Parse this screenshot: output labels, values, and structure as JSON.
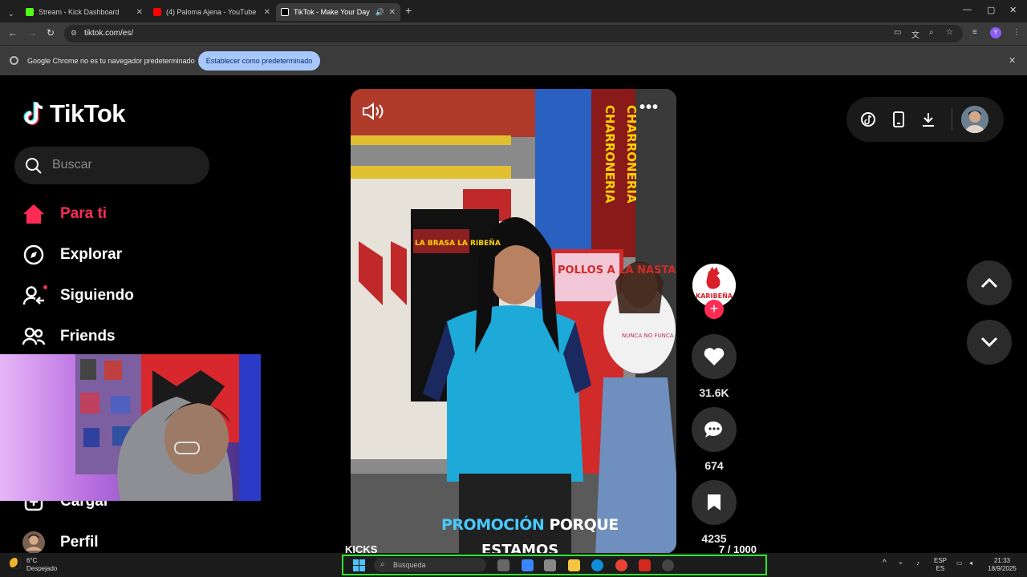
{
  "browser": {
    "tabs": [
      {
        "title": "Stream - Kick Dashboard",
        "color": "#53fc18"
      },
      {
        "title": "(4) Paloma Ajena - YouTube",
        "color": "#ff0000"
      },
      {
        "title": "TikTok - Make Your Day",
        "color": "#000000"
      }
    ],
    "url": "tiktok.com/es/",
    "profile_initial": "Y"
  },
  "infobar": {
    "message": "Google Chrome no es tu navegador predeterminado",
    "button": "Establecer como predeterminado"
  },
  "tiktok": {
    "logo": "TikTok",
    "search_placeholder": "Buscar",
    "nav": [
      {
        "label": "Para ti",
        "icon": "home-icon"
      },
      {
        "label": "Explorar",
        "icon": "compass-icon"
      },
      {
        "label": "Siguiendo",
        "icon": "following-icon"
      },
      {
        "label": "Friends",
        "icon": "friends-icon"
      },
      {
        "label": "Cargar",
        "icon": "upload-icon"
      },
      {
        "label": "Perfil",
        "icon": "profile-icon"
      }
    ],
    "video": {
      "caption_highlight": "PROMOCIÓN",
      "caption_rest": "PORQUE",
      "caption_line2": "ESTAMOS",
      "channel": "KICKS",
      "signs": [
        "CHARRONERIA",
        "POLLOS A LA NASTA",
        "NUNCA NO FUNCA",
        "LA BRASA LA RIBEÑA"
      ],
      "account_logo_text": "KARIBEÑA"
    },
    "actions": {
      "likes": "31.6K",
      "comments": "674",
      "saves": "4235"
    },
    "position": {
      "current": "7",
      "total": "/ 1000"
    }
  },
  "taskbar": {
    "weather_temp": "6°C",
    "weather_desc": "Despejado",
    "search_placeholder": "Búsqueda",
    "lang_top": "ESP",
    "lang_bottom": "ES",
    "time": "21:33",
    "date": "18/9/2025"
  }
}
